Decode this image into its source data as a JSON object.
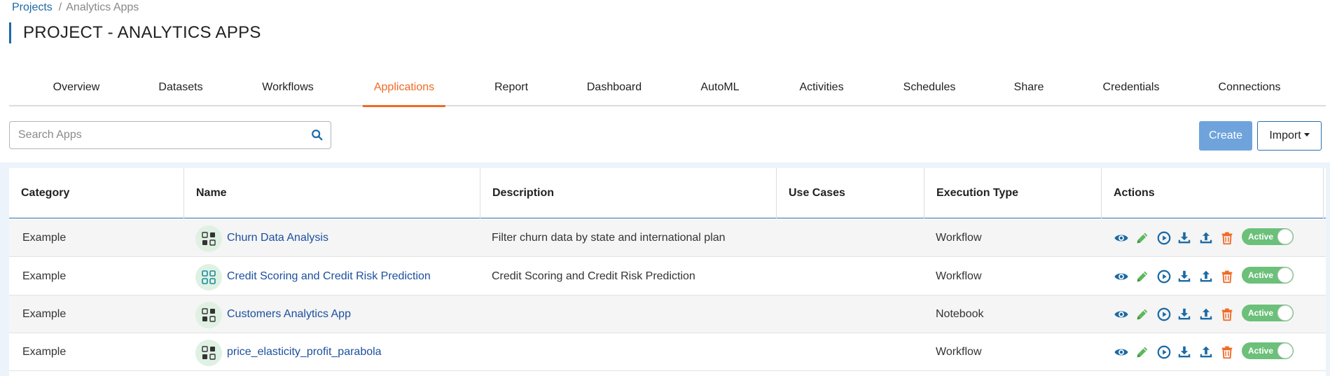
{
  "breadcrumb": {
    "root": "Projects",
    "separator": "/",
    "current": "Analytics Apps"
  },
  "page_title": "PROJECT - ANALYTICS APPS",
  "tabs": [
    {
      "label": "Overview"
    },
    {
      "label": "Datasets"
    },
    {
      "label": "Workflows"
    },
    {
      "label": "Applications",
      "active": true
    },
    {
      "label": "Report"
    },
    {
      "label": "Dashboard"
    },
    {
      "label": "AutoML"
    },
    {
      "label": "Activities"
    },
    {
      "label": "Schedules"
    },
    {
      "label": "Share"
    },
    {
      "label": "Credentials"
    },
    {
      "label": "Connections"
    }
  ],
  "search": {
    "placeholder": "Search Apps",
    "value": "",
    "icon": "search-icon"
  },
  "toolbar": {
    "create_label": "Create",
    "import_label": "Import"
  },
  "table": {
    "headers": [
      "Category",
      "Name",
      "Description",
      "Use Cases",
      "Execution Type",
      "Actions"
    ],
    "rows": [
      {
        "category": "Example",
        "name": "Churn Data Analysis",
        "description": "Filter churn data by state and international plan",
        "use_cases": "",
        "execution_type": "Workflow",
        "status": "Active"
      },
      {
        "category": "Example",
        "name": "Credit Scoring and Credit Risk Prediction",
        "description": "Credit Scoring and Credit Risk Prediction",
        "use_cases": "",
        "execution_type": "Workflow",
        "status": "Active"
      },
      {
        "category": "Example",
        "name": "Customers Analytics App",
        "description": "",
        "use_cases": "",
        "execution_type": "Notebook",
        "status": "Active"
      },
      {
        "category": "Example",
        "name": "price_elasticity_profit_parabola",
        "description": "",
        "use_cases": "",
        "execution_type": "Workflow",
        "status": "Active"
      }
    ],
    "row_actions": [
      "view-icon",
      "edit-icon",
      "run-icon",
      "download-icon",
      "upload-icon",
      "delete-icon"
    ]
  },
  "colors": {
    "accent": "#1b6aa5",
    "active_tab": "#ee6a26",
    "link": "#1b4f9e",
    "create_button": "#6fa3dc",
    "toggle_active": "#6cc07a",
    "edit_icon": "#5cb85c",
    "delete_icon": "#ee6a26"
  }
}
